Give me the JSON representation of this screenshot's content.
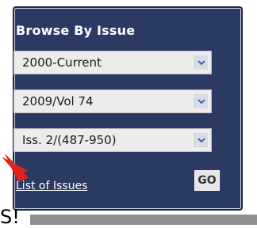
{
  "widget": {
    "title": "Browse By Issue",
    "dropdowns": [
      {
        "selected": "2000-Current"
      },
      {
        "selected": "2009/Vol 74"
      },
      {
        "selected": "Iss. 2/(487-950)"
      }
    ],
    "list_link": "List of Issues",
    "go_label": "GO"
  },
  "bottom": {
    "partial_text": "S!"
  },
  "colors": {
    "panel_bg": "#2b3a63",
    "select_bg": "#ececec",
    "arrow": "#e0241b"
  },
  "icons": {
    "dropdown": "chevron-down-icon",
    "pointer": "red-arrow-icon"
  }
}
